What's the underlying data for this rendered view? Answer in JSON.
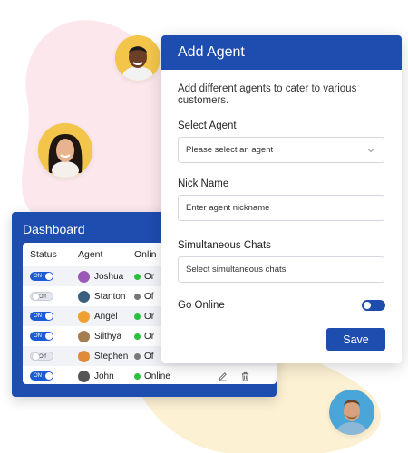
{
  "dashboard": {
    "title": "Dashboard",
    "columns": {
      "status": "Status",
      "agent": "Agent",
      "online": "Onlin"
    },
    "rows": [
      {
        "status": "ON",
        "agent": "Joshua",
        "online": "Or",
        "online_color": "#28c03c",
        "avatar_color": "#9b59b6"
      },
      {
        "status": "Off",
        "agent": "Stanton",
        "online": "Of",
        "online_color": "#777777",
        "avatar_color": "#3b5f7d"
      },
      {
        "status": "ON",
        "agent": "Angel",
        "online": "Or",
        "online_color": "#28c03c",
        "avatar_color": "#f0a030"
      },
      {
        "status": "ON",
        "agent": "Silthya",
        "online": "Or",
        "online_color": "#28c03c",
        "avatar_color": "#a67c52"
      },
      {
        "status": "Off",
        "agent": "Stephen",
        "online": "Of",
        "online_color": "#777777",
        "avatar_color": "#e08a3c"
      },
      {
        "status": "ON",
        "agent": "John",
        "online": "Online",
        "online_color": "#28c03c",
        "avatar_color": "#555555"
      }
    ]
  },
  "add_agent": {
    "title": "Add Agent",
    "description": "Add different agents to cater to various customers.",
    "select_agent_label": "Select Agent",
    "select_agent_placeholder": "Please select an agent",
    "nick_name_label": "Nick Name",
    "nick_name_placeholder": "Enter agent nickname",
    "simultaneous_chats_label": "Simultaneous Chats",
    "simultaneous_chats_placeholder": "Select simultaneous chats",
    "go_online_label": "Go Online",
    "go_online_state": true,
    "save_label": "Save"
  },
  "colors": {
    "primary": "#1e4db0",
    "online": "#28c03c",
    "offline": "#777777",
    "blob_pink": "#fce8ec",
    "blob_yellow": "#fdf1d4",
    "avatar_bg": "#f3c64b"
  },
  "icons": [
    "edit-icon",
    "trash-icon",
    "chevron-down-icon"
  ]
}
